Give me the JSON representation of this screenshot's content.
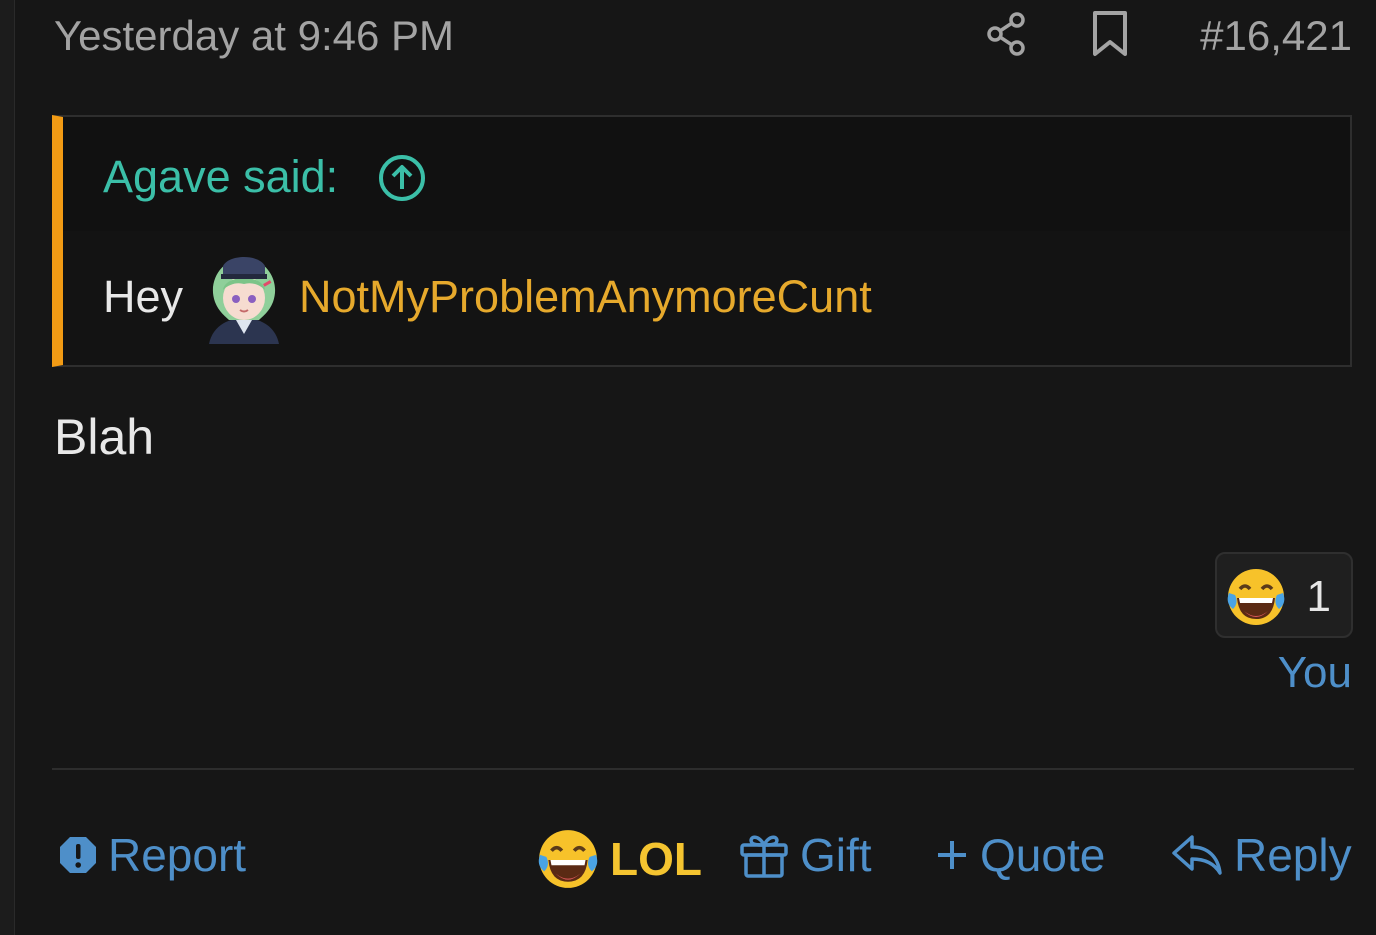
{
  "post": {
    "timestamp": "Yesterday at 9:46 PM",
    "number": "#16,421",
    "message": "Blah"
  },
  "quote": {
    "author_label": "Agave said:",
    "prefix": "Hey",
    "mention": "NotMyProblemAnymoreCunt"
  },
  "reactions": {
    "count": "1",
    "users": "You"
  },
  "actions": {
    "report": "Report",
    "lol": "LOL",
    "gift": "Gift",
    "quote": "Quote",
    "reply": "Reply"
  },
  "colors": {
    "background": "#161616",
    "quote_accent": "#f29b14",
    "link": "#4e8fc9",
    "quote_author": "#3bbfa8",
    "mention": "#e6a92c",
    "lol": "#f4c430"
  }
}
